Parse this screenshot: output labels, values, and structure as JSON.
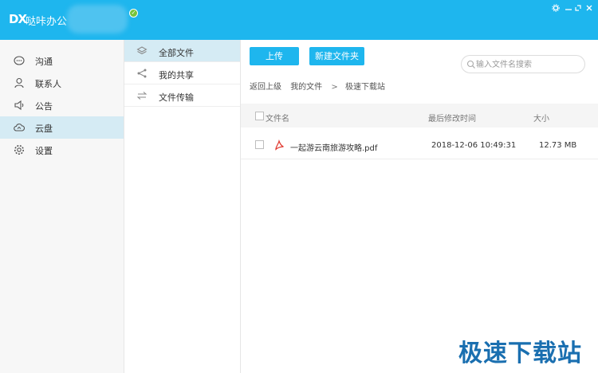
{
  "app": {
    "logo": "DX",
    "name": "哒咔办公"
  },
  "window_controls": [
    "settings-icon",
    "minimize-icon",
    "maximize-icon",
    "close-icon"
  ],
  "colors": {
    "accent": "#1eb6ee",
    "active_row": "#d5ebf4",
    "watermark": "#1a6fb0"
  },
  "nav": {
    "items": [
      {
        "label": "沟通",
        "icon": "chat-bubble-icon"
      },
      {
        "label": "联系人",
        "icon": "person-icon"
      },
      {
        "label": "公告",
        "icon": "megaphone-icon"
      },
      {
        "label": "云盘",
        "icon": "cloud-icon",
        "active": true
      },
      {
        "label": "设置",
        "icon": "gear-icon"
      }
    ]
  },
  "subnav": {
    "items": [
      {
        "label": "全部文件",
        "icon": "layers-icon",
        "active": true
      },
      {
        "label": "我的共享",
        "icon": "share-icon"
      },
      {
        "label": "文件传输",
        "icon": "transfer-icon"
      }
    ]
  },
  "toolbar": {
    "upload_label": "上传",
    "new_folder_label": "新建文件夹"
  },
  "search": {
    "placeholder": "输入文件名搜索"
  },
  "breadcrumb": {
    "back": "返回上级",
    "root": "我的文件",
    "separator": ">",
    "current": "极速下载站"
  },
  "table": {
    "headers": {
      "name": "文件名",
      "modified": "最后修改时间",
      "size": "大小"
    },
    "rows": [
      {
        "name": "一起游云南旅游攻略.pdf",
        "modified": "2018-12-06 10:49:31",
        "size": "12.73 MB",
        "icon": "pdf-icon"
      }
    ]
  },
  "watermark": "极速下载站"
}
